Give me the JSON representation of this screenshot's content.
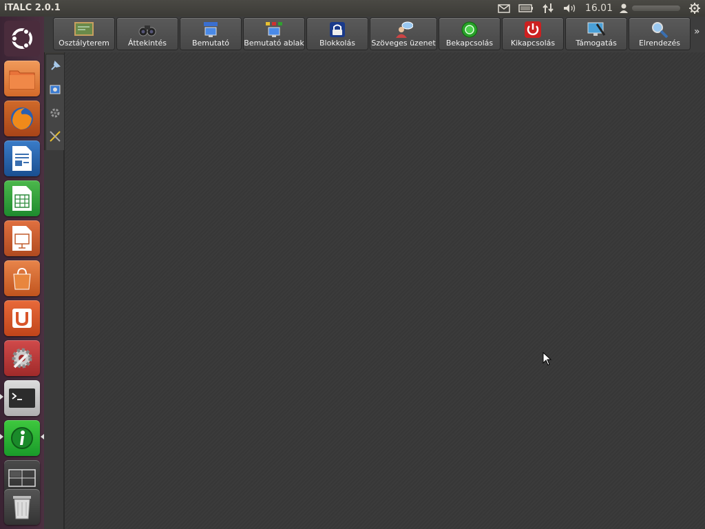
{
  "window": {
    "title": "iTALC 2.0.1"
  },
  "panel": {
    "clock": "16.01",
    "icons": [
      "mail-icon",
      "battery-icon",
      "network-icon",
      "volume-icon",
      "user-icon",
      "power-icon"
    ]
  },
  "launcher": {
    "items": [
      {
        "name": "ubuntu-dash-icon",
        "color": "#4a2c3c"
      },
      {
        "name": "files-icon",
        "color": "#e07a3a"
      },
      {
        "name": "firefox-icon",
        "color": "#c05a1e"
      },
      {
        "name": "writer-icon",
        "color": "#1f62a8"
      },
      {
        "name": "calc-icon",
        "color": "#2a9a3c"
      },
      {
        "name": "impress-icon",
        "color": "#c0542a"
      },
      {
        "name": "software-center-icon",
        "color": "#d86830"
      },
      {
        "name": "ubuntu-one-icon",
        "color": "#d8552a"
      },
      {
        "name": "system-settings-icon",
        "color": "#b83a3a"
      },
      {
        "name": "terminal-icon",
        "color": "#2c2c2c"
      },
      {
        "name": "italc-icon",
        "color": "#1fa02c"
      },
      {
        "name": "workspace-switcher-icon",
        "color": "#3a3a3a"
      },
      {
        "name": "trash-icon",
        "color": "#4a4a4a"
      }
    ]
  },
  "toolbar": {
    "buttons": [
      {
        "label": "Osztályterem",
        "icon": "classroom-icon"
      },
      {
        "label": "Áttekintés",
        "icon": "overview-icon"
      },
      {
        "label": "Bemutató",
        "icon": "demo-icon"
      },
      {
        "label": "Bemutató ablak",
        "icon": "demo-window-icon"
      },
      {
        "label": "Blokkolás",
        "icon": "lock-icon"
      },
      {
        "label": "Szöveges üzenet",
        "icon": "message-icon"
      },
      {
        "label": "Bekapcsolás",
        "icon": "power-on-icon"
      },
      {
        "label": "Kikapcsolás",
        "icon": "power-off-icon"
      },
      {
        "label": "Támogatás",
        "icon": "support-icon"
      },
      {
        "label": "Elrendezés",
        "icon": "arrange-icon"
      }
    ],
    "more": "»"
  },
  "side_tools": [
    "pin-icon",
    "snapshot-icon",
    "settings-icon",
    "tools-icon"
  ]
}
